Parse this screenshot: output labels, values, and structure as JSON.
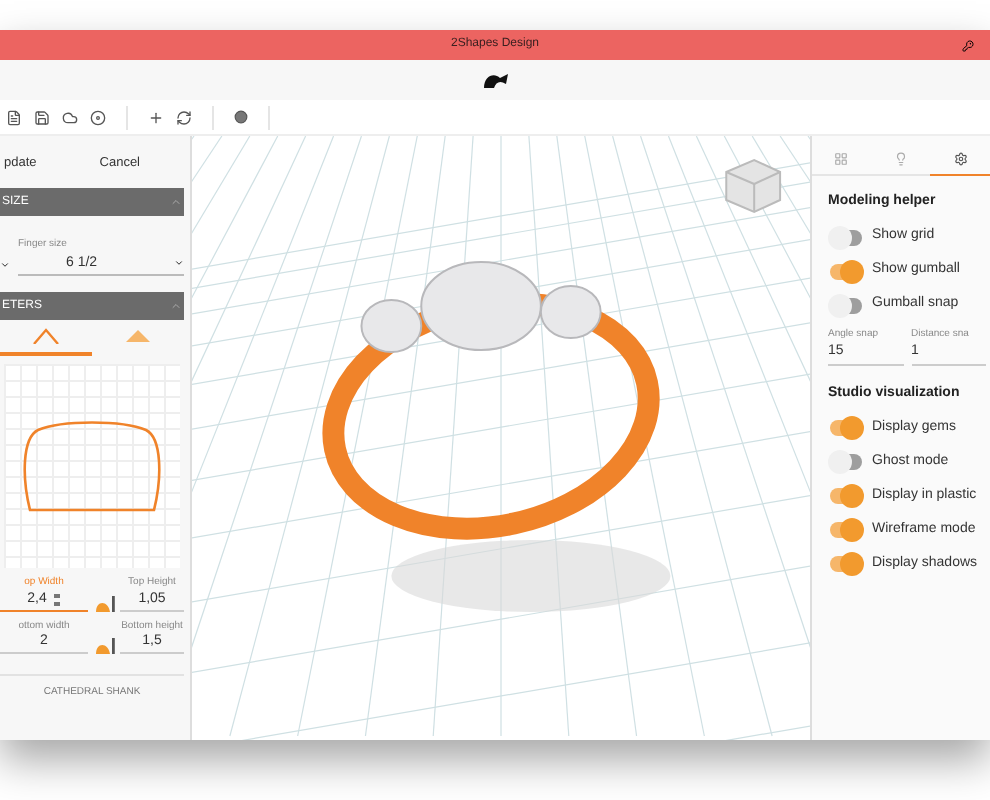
{
  "window": {
    "title": "2Shapes Design"
  },
  "left_panel": {
    "actions": [
      {
        "label": "pdate"
      },
      {
        "label": "Cancel"
      }
    ],
    "sections": [
      {
        "title": "SIZE",
        "expanded": true
      },
      {
        "title": "ETERS",
        "expanded": true
      }
    ],
    "finger_size": {
      "label": "Finger size",
      "value": "6 1/2"
    },
    "profile_tabs": [
      {
        "selected": true
      },
      {
        "selected": false
      }
    ],
    "fields": [
      {
        "label": "op Width",
        "value": "2,4",
        "focused": true
      },
      {
        "label": "Top Height",
        "value": "1,05",
        "focused": false
      },
      {
        "label": "ottom width",
        "value": "2",
        "focused": false
      },
      {
        "label": "Bottom height",
        "value": "1,5",
        "focused": false
      }
    ],
    "footer_label": "CATHEDRAL SHANK"
  },
  "right_panel": {
    "tabs": [
      {
        "selected": false
      },
      {
        "selected": false
      },
      {
        "selected": true
      }
    ],
    "modeling_helper": {
      "title": "Modeling helper",
      "toggles": [
        {
          "label": "Show grid",
          "on": false
        },
        {
          "label": "Show gumball",
          "on": true
        },
        {
          "label": "Gumball snap",
          "on": false
        }
      ]
    },
    "snaps": [
      {
        "label": "Angle snap",
        "value": "15"
      },
      {
        "label": "Distance sna",
        "value": "1"
      }
    ],
    "studio_visualization": {
      "title": "Studio visualization",
      "toggles": [
        {
          "label": "Display gems",
          "on": true
        },
        {
          "label": "Ghost mode",
          "on": false
        },
        {
          "label": "Display in plastic",
          "on": true
        },
        {
          "label": "Wireframe mode",
          "on": true
        },
        {
          "label": "Display shadows",
          "on": true
        }
      ]
    }
  }
}
